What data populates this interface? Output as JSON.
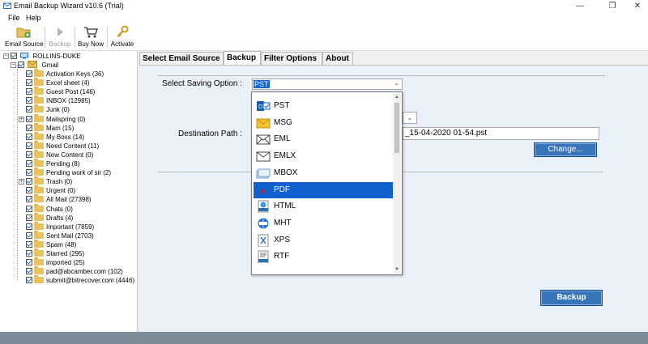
{
  "window": {
    "title": "Email Backup Wizard v10.6 (Trial)"
  },
  "menu": {
    "file": "File",
    "help": "Help"
  },
  "toolbar": {
    "email_source": "Email Source",
    "backup": "Backup",
    "buy_now": "Buy Now",
    "activate": "Activate"
  },
  "tree": {
    "root": "ROLLINS-DUKE",
    "account": "Gmail",
    "items": [
      {
        "label": "Activation Keys (36)",
        "checked": true
      },
      {
        "label": "Excel sheet (4)",
        "checked": true
      },
      {
        "label": "Guest Post (146)",
        "checked": true
      },
      {
        "label": "INBOX (12985)",
        "checked": true
      },
      {
        "label": "Junk (0)",
        "checked": true
      },
      {
        "label": "Mailspring (0)",
        "checked": true
      },
      {
        "label": "Mam (15)",
        "checked": true
      },
      {
        "label": "My Boss (14)",
        "checked": true
      },
      {
        "label": "Need Content (11)",
        "checked": true
      },
      {
        "label": "New Content (0)",
        "checked": true
      },
      {
        "label": "Pending (8)",
        "checked": true
      },
      {
        "label": "Pending work of sir (2)",
        "checked": true
      },
      {
        "label": "Trash (0)",
        "checked": true
      },
      {
        "label": "Urgent (0)",
        "checked": true
      },
      {
        "label": "All Mail (27398)",
        "checked": true
      },
      {
        "label": "Chats (0)",
        "checked": true
      },
      {
        "label": "Drafts (4)",
        "checked": true
      },
      {
        "label": "Important (7859)",
        "checked": true
      },
      {
        "label": "Sent Mail (2703)",
        "checked": true
      },
      {
        "label": "Spam (48)",
        "checked": true
      },
      {
        "label": "Starred (295)",
        "checked": true
      },
      {
        "label": "imported (25)",
        "checked": true
      },
      {
        "label": "pad@abcamber.com (102)",
        "checked": true
      },
      {
        "label": "submit@bitrecover.com (4446)",
        "checked": true
      }
    ]
  },
  "tabs": {
    "select_source": "Select Email Source",
    "backup": "Backup",
    "filter": "Filter Options",
    "about": "About"
  },
  "form": {
    "saving_label": "Select Saving Option :",
    "saving_value": "PST",
    "dest_label": "Destination Path :",
    "dest_value": "_15-04-2020 01-54.pst",
    "change_button": "Change...",
    "backup_button": "Backup"
  },
  "dropdown": {
    "options": [
      "PST",
      "MSG",
      "EML",
      "EMLX",
      "MBOX",
      "PDF",
      "HTML",
      "MHT",
      "XPS",
      "RTF"
    ],
    "selected": "PDF"
  },
  "colors": {
    "accent": "#1060cf",
    "button": "#3874b8",
    "panel": "#eaf1f8",
    "status": "#7d8b99"
  }
}
